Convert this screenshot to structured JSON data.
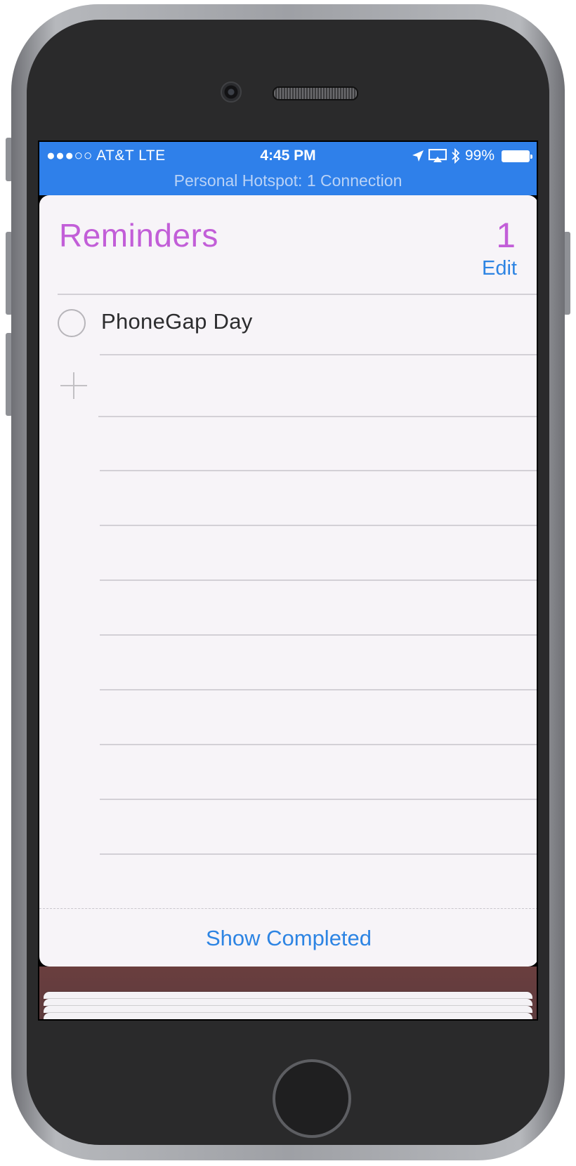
{
  "statusbar": {
    "carrier": "●●●○○ AT&T   LTE",
    "time": "4:45 PM",
    "battery": "99%",
    "hotspot": "Personal Hotspot: 1 Connection",
    "color": "#2f80ea"
  },
  "reminders": {
    "title": "Reminders",
    "count": "1",
    "edit_label": "Edit",
    "items": [
      {
        "text": "PhoneGap Day",
        "completed": false
      }
    ],
    "show_completed_label": "Show Completed",
    "accent_color": "#c25ed8",
    "link_color": "#2d84e3"
  },
  "icons": {
    "location": "location-arrow-icon",
    "airplay": "airplay-icon",
    "bluetooth": "bluetooth-icon",
    "battery": "battery-icon",
    "add": "plus-icon"
  }
}
